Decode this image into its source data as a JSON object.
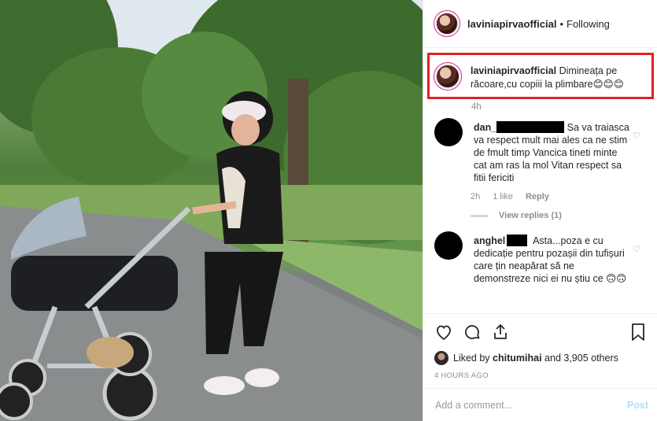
{
  "post": {
    "username": "laviniapirvaofficial",
    "separator": "•",
    "follow_status": "Following"
  },
  "caption": {
    "username": "laviniapirvaofficial",
    "text": "Dimineața pe răcoare,cu copiii la plimbare😊😊😊",
    "time": "4h"
  },
  "comments": [
    {
      "username": "dan_",
      "text": "Sa va traiasca va respect mult mai ales ca ne stim de fmult timp Vancica tineti minte cat am ras la mol Vitan respect sa fitii fericiti",
      "time": "2h",
      "likes": "1 like",
      "reply_label": "Reply",
      "view_replies": "View replies (1)"
    },
    {
      "username": "anghel",
      "text": "Asta...poza e cu dedicație pentru pozașii din tufișuri care țin neapărat să ne demonstreze nici ei nu știu ce 🙃🙃"
    }
  ],
  "likes": {
    "prefix": "Liked by",
    "user": "chitumihai",
    "rest": "and 3,905 others"
  },
  "timestamp": "4 HOURS AGO",
  "add_comment": {
    "placeholder": "Add a comment...",
    "post_label": "Post"
  },
  "icons": [
    "heart-icon",
    "comment-icon",
    "share-icon",
    "bookmark-icon"
  ]
}
